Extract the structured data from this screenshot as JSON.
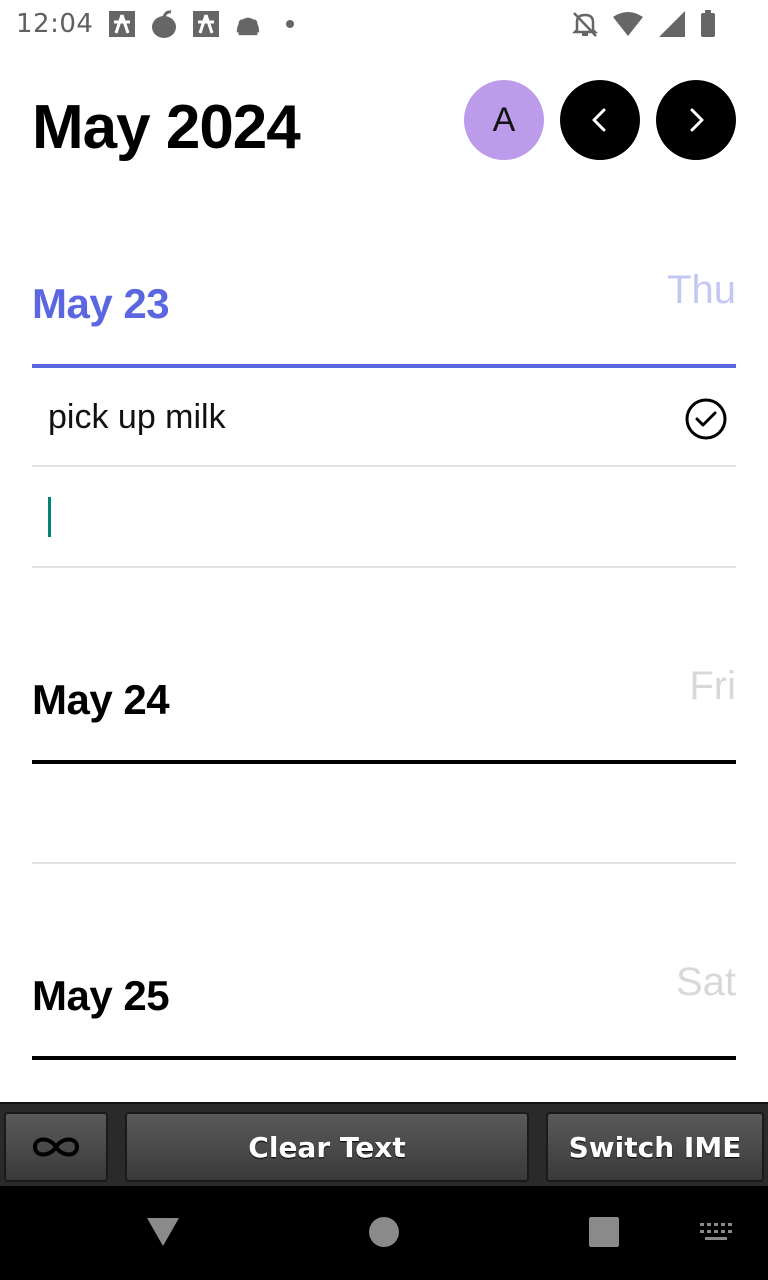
{
  "status_bar": {
    "time": "12:04",
    "left_icons": [
      "app-notification-icon",
      "apple-icon",
      "app-notification-icon",
      "android-icon",
      "dot-icon"
    ],
    "right_icons": [
      "notifications-off-icon",
      "wifi-icon",
      "signal-icon",
      "battery-icon"
    ]
  },
  "header": {
    "month_title": "May 2024",
    "avatar_initial": "A",
    "avatar_color": "#bb9bea"
  },
  "days": [
    {
      "date": "May 23",
      "weekday": "Thu",
      "is_today": true,
      "accent": "#5a67e0",
      "weekday_color": "#c3c8f3",
      "tasks": [
        {
          "text": "pick up milk",
          "done": false
        }
      ],
      "new_task_input": {
        "value": "",
        "focused": true
      }
    },
    {
      "date": "May 24",
      "weekday": "Fri",
      "is_today": false,
      "tasks": []
    },
    {
      "date": "May 25",
      "weekday": "Sat",
      "is_today": false,
      "tasks": []
    }
  ],
  "ime_toolbar": {
    "infinity_icon": "infinity-icon",
    "clear_label": "Clear Text",
    "switch_label": "Switch IME"
  },
  "nav_bar": {
    "icons": [
      "back-icon",
      "home-icon",
      "recents-icon",
      "keyboard-icon"
    ]
  }
}
